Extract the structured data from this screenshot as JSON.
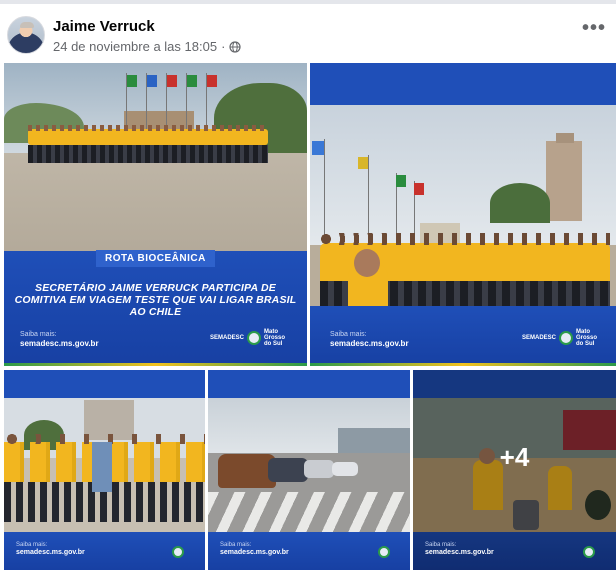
{
  "post": {
    "author": "Jaime Verruck",
    "timestamp": "24 de noviembre a las 18:05",
    "separator": "·",
    "more_icon": "more-options-icon",
    "more_label": "•••",
    "privacy_icon": "globe-icon"
  },
  "photos": {
    "tile1": {
      "tag": "ROTA BIOCEÂNICA",
      "headline": "SECRETÁRIO JAIME VERRUCK PARTICIPA DE COMITIVA EM VIAGEM TESTE QUE VAI LIGAR BRASIL AO CHILE",
      "site_label": "Saiba mais:",
      "site_url": "semadesc.ms.gov.br",
      "logo_text": "SEMADESC",
      "logo_ms": "Mato Grosso do Sul"
    },
    "tile2": {
      "site_label": "Saiba mais:",
      "site_url": "semadesc.ms.gov.br",
      "logo_text": "SEMADESC",
      "logo_ms": "Mato Grosso do Sul"
    },
    "tile3": {
      "site_label": "Saiba mais:",
      "site_url": "semadesc.ms.gov.br"
    },
    "tile4": {
      "site_label": "Saiba mais:",
      "site_url": "semadesc.ms.gov.br"
    },
    "tile5": {
      "site_label": "Saiba mais:",
      "site_url": "semadesc.ms.gov.br"
    },
    "more_count": "+4"
  },
  "colors": {
    "brand_blue": "#1f4fb8",
    "shirt_yellow": "#f2b61f",
    "facebook_gray": "#65676b"
  }
}
